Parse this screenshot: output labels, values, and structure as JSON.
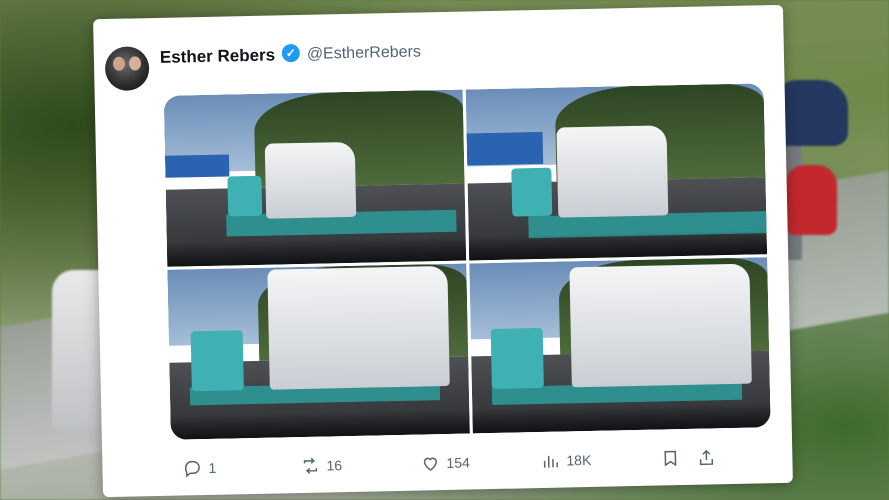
{
  "tweet": {
    "author_name": "Esther Rebers",
    "author_handle": "@EstherRebers",
    "verified_icon": "verified-badge-icon"
  },
  "actions": {
    "replies": "1",
    "reposts": "16",
    "likes": "154",
    "views": "18K"
  },
  "media": {
    "count": 4
  },
  "colors": {
    "verified_blue": "#1d9bf0",
    "text_primary": "#0f1419",
    "text_secondary": "#536471"
  }
}
